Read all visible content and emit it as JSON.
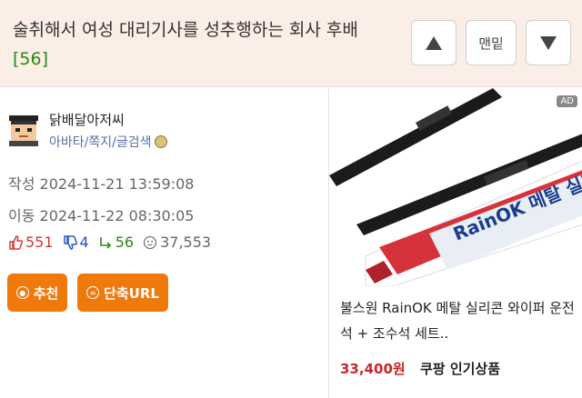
{
  "post": {
    "title": "술취해서 여성 대리기사를 성추행하는 회사 후배",
    "comment_count": "[56]"
  },
  "nav": {
    "bottom_label": "맨밑"
  },
  "author": {
    "nickname": "닭배달아저씨",
    "links": "아바타/쪽지/글검색"
  },
  "meta": {
    "written": "작성 2024-11-21 13:59:08",
    "moved": "이동 2024-11-22 08:30:05"
  },
  "stats": {
    "likes": "551",
    "dislikes": "4",
    "comments": "56",
    "views": "37,553"
  },
  "actions": {
    "recommend_label": "추천",
    "short_url_label": "단축URL"
  },
  "ad": {
    "badge": "AD",
    "brand_text": "RainOK 메탈 실리콘",
    "title": "불스원 RainOK 메탈 실리콘 와이퍼 운전석 + 조수석 세트..",
    "price": "33,400원",
    "seller": "쿠팡 인기상품"
  },
  "colors": {
    "header_bg": "#fbeee6",
    "accent_orange": "#f0790b",
    "like_red": "#d23838",
    "dislike_blue": "#2457c4",
    "comment_green": "#2a8a14",
    "price_red": "#c8262b"
  },
  "icons": [
    "arrow-up-icon",
    "arrow-down-icon",
    "thumbs-up-icon",
    "thumbs-down-icon",
    "reply-icon",
    "eye-icon",
    "medal-icon"
  ]
}
